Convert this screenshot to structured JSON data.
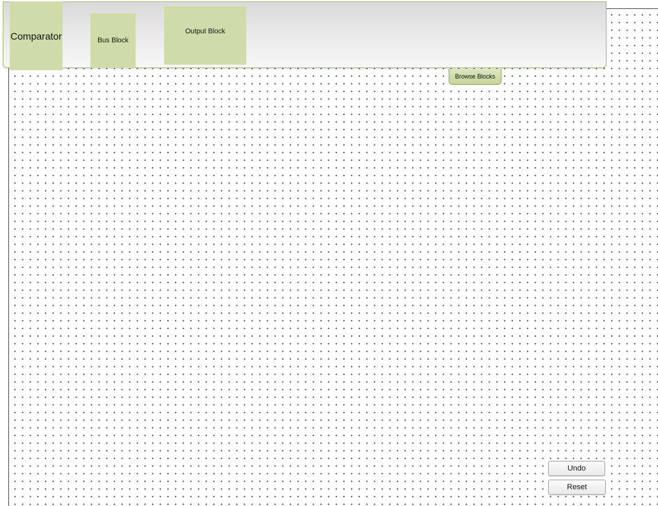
{
  "palette": {
    "blocks": [
      {
        "label": "Comparator"
      },
      {
        "label": "Bus Block"
      },
      {
        "label": "Output Block"
      }
    ],
    "browse_label": "Browse Blocks"
  },
  "controls": {
    "undo_label": "Undo",
    "reset_label": "Reset"
  },
  "colors": {
    "block_fill": "#cfdca9",
    "palette_border": "#a9bd7e",
    "grid_dot": "#3a3a3a"
  }
}
